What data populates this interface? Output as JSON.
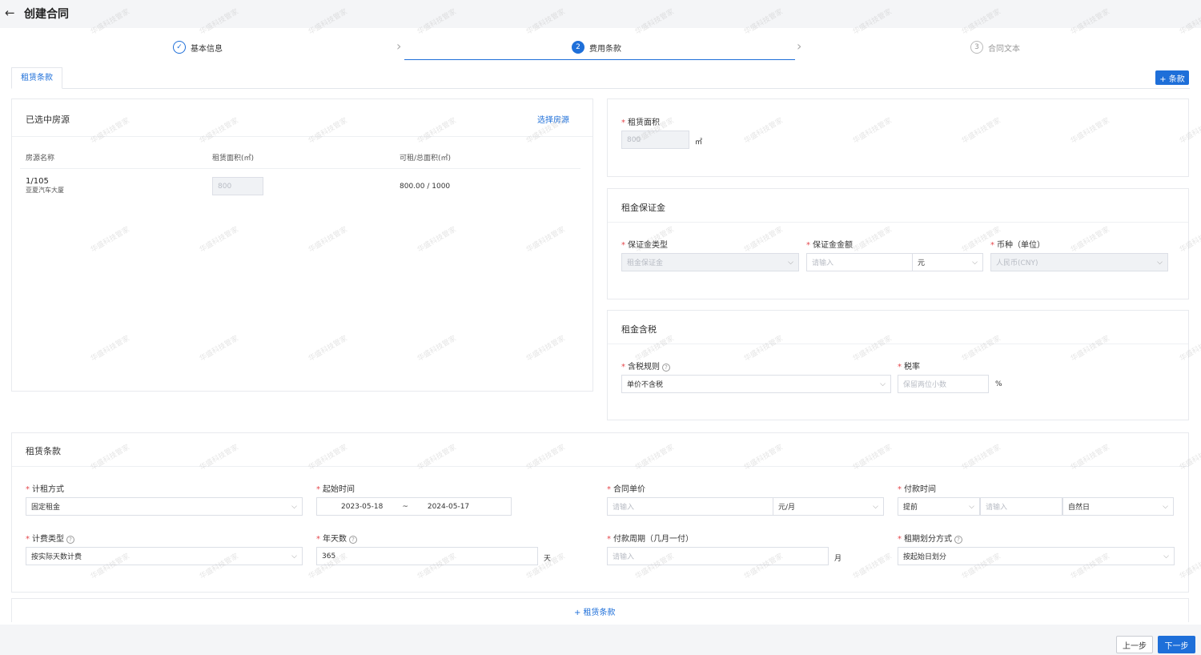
{
  "header": {
    "title": "创建合同",
    "back_icon": "arrow-left-icon"
  },
  "steps": [
    {
      "label": "基本信息",
      "marker": "✓",
      "state": "done"
    },
    {
      "label": "费用条款",
      "marker": "2",
      "state": "active"
    },
    {
      "label": "合同文本",
      "marker": "3",
      "state": "todo"
    }
  ],
  "tabs": {
    "active": "租赁条款"
  },
  "add_clause_button": "+ 条款",
  "houses": {
    "title": "已选中房源",
    "select_link": "选择房源",
    "columns": [
      "房源名称",
      "租赁面积(㎡)",
      "可租/总面积(㎡)"
    ],
    "rows": [
      {
        "name": "1/105",
        "building": "亚夏汽车大厦",
        "area": "800",
        "available_total": "800.00 / 1000"
      }
    ]
  },
  "lease_area": {
    "label": "租赁面积",
    "value": "800",
    "unit": "㎡"
  },
  "deposit": {
    "title": "租金保证金",
    "type_label": "保证金类型",
    "type_value": "租金保证金",
    "amount_label": "保证金金额",
    "amount_placeholder": "请输入",
    "amount_unit": "元",
    "currency_label": "币种（单位）",
    "currency_value": "人民币(CNY)"
  },
  "tax": {
    "title": "租金含税",
    "rule_label": "含税规则",
    "rule_value": "单价不含税",
    "rate_label": "税率",
    "rate_placeholder": "保留两位小数",
    "rate_unit": "%"
  },
  "lease_terms": {
    "title": "租赁条款",
    "rent_method_label": "计租方式",
    "rent_method_value": "固定租金",
    "start_time_label": "起始时间",
    "start_date": "2023-05-18",
    "range_sep": "~",
    "end_date": "2024-05-17",
    "unit_price_label": "合同单价",
    "unit_price_placeholder": "请输入",
    "unit_price_unit": "元/月",
    "pay_time_label": "付款时间",
    "pay_time_mode": "提前",
    "pay_time_placeholder": "请输入",
    "pay_time_day_type": "自然日",
    "billing_type_label": "计费类型",
    "billing_type_value": "按实际天数计费",
    "year_days_label": "年天数",
    "year_days_value": "365",
    "year_days_unit": "天",
    "pay_cycle_label": "付款周期（几月一付）",
    "pay_cycle_placeholder": "请输入",
    "pay_cycle_unit": "月",
    "period_split_label": "租期划分方式",
    "period_split_value": "按起始日划分"
  },
  "add_lease_term": "+ 租赁条款",
  "footer": {
    "prev": "上一步",
    "next": "下一步"
  },
  "watermark_text": "华盛科技管家",
  "colors": {
    "primary": "#1e6fd9",
    "required": "#e5484d"
  }
}
